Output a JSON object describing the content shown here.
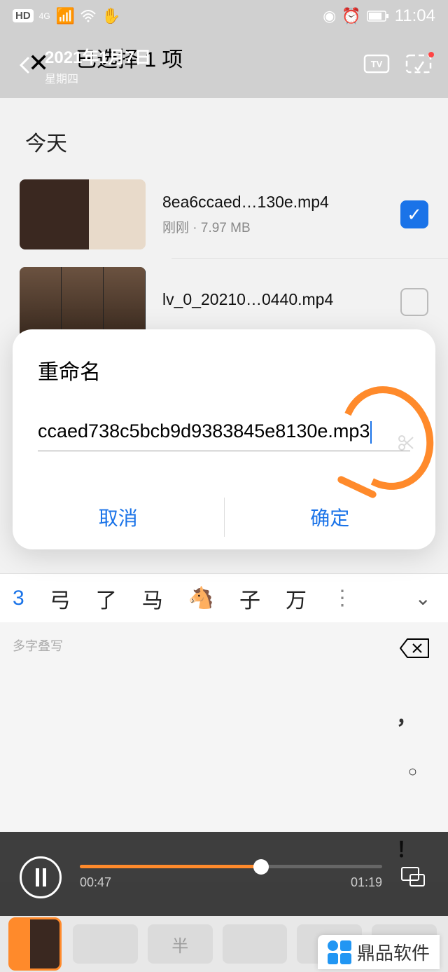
{
  "statusbar": {
    "hd": "HD",
    "net": "4G",
    "time": "11:04"
  },
  "header": {
    "date": "2021年1月7日",
    "day": "星期四",
    "selected": "已选择 1 项"
  },
  "section_today": "今天",
  "files": [
    {
      "name": "8ea6ccaed…130e.mp4",
      "meta": "刚刚 · 7.97 MB",
      "checked": true
    },
    {
      "name": "lv_0_20210…0440.mp4",
      "meta": "",
      "checked": false
    }
  ],
  "dialog": {
    "title": "重命名",
    "value": "ccaed738c5bcb9d9383845e8130e.mp3",
    "cancel": "取消",
    "confirm": "确定"
  },
  "ime": {
    "first": "3",
    "items": [
      "弓",
      "了",
      "马",
      "🐴",
      "子",
      "万"
    ],
    "hint": "多字叠写"
  },
  "player": {
    "current": "00:47",
    "total": "01:19"
  },
  "kbd_faded": [
    "",
    "半",
    "",
    "",
    "",
    ""
  ],
  "watermark": "鼎品软件"
}
